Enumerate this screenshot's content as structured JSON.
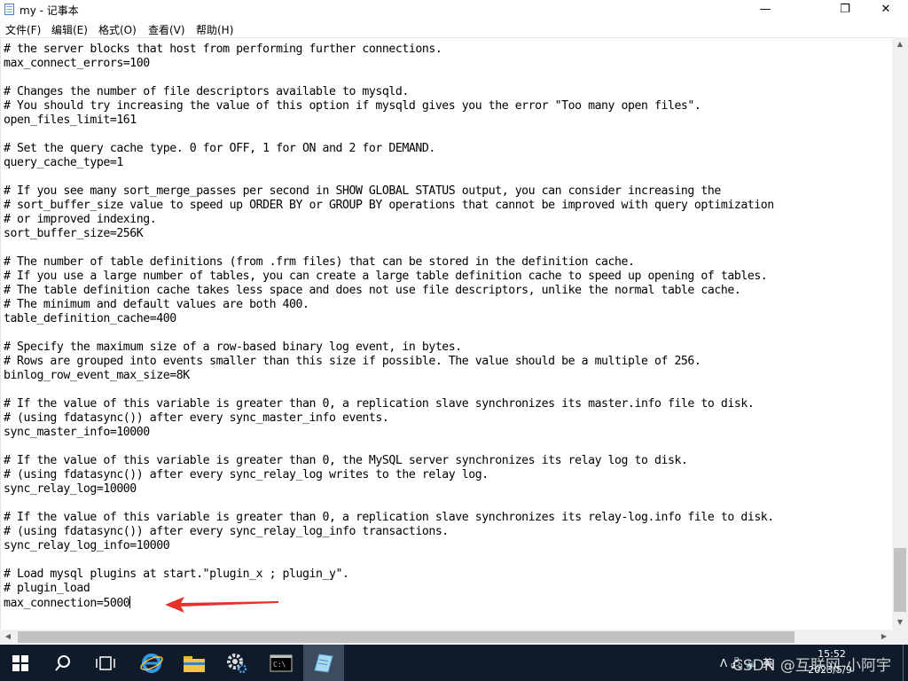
{
  "window": {
    "title": "my - 记事本",
    "minimize_glyph": "—",
    "maximize_glyph": "❐",
    "close_glyph": "✕"
  },
  "menu": {
    "items": [
      "文件(F)",
      "编辑(E)",
      "格式(O)",
      "查看(V)",
      "帮助(H)"
    ]
  },
  "editor": {
    "lines": [
      "# the server blocks that host from performing further connections.",
      "max_connect_errors=100",
      "",
      "# Changes the number of file descriptors available to mysqld.",
      "# You should try increasing the value of this option if mysqld gives you the error \"Too many open files\".",
      "open_files_limit=161",
      "",
      "# Set the query cache type. 0 for OFF, 1 for ON and 2 for DEMAND.",
      "query_cache_type=1",
      "",
      "# If you see many sort_merge_passes per second in SHOW GLOBAL STATUS output, you can consider increasing the",
      "# sort_buffer_size value to speed up ORDER BY or GROUP BY operations that cannot be improved with query optimization",
      "# or improved indexing.",
      "sort_buffer_size=256K",
      "",
      "# The number of table definitions (from .frm files) that can be stored in the definition cache.",
      "# If you use a large number of tables, you can create a large table definition cache to speed up opening of tables.",
      "# The table definition cache takes less space and does not use file descriptors, unlike the normal table cache.",
      "# The minimum and default values are both 400.",
      "table_definition_cache=400",
      "",
      "# Specify the maximum size of a row-based binary log event, in bytes.",
      "# Rows are grouped into events smaller than this size if possible. The value should be a multiple of 256.",
      "binlog_row_event_max_size=8K",
      "",
      "# If the value of this variable is greater than 0, a replication slave synchronizes its master.info file to disk.",
      "# (using fdatasync()) after every sync_master_info events.",
      "sync_master_info=10000",
      "",
      "# If the value of this variable is greater than 0, the MySQL server synchronizes its relay log to disk.",
      "# (using fdatasync()) after every sync_relay_log writes to the relay log.",
      "sync_relay_log=10000",
      "",
      "# If the value of this variable is greater than 0, a replication slave synchronizes its relay-log.info file to disk.",
      "# (using fdatasync()) after every sync_relay_log_info transactions.",
      "sync_relay_log_info=10000",
      "",
      "# Load mysql plugins at start.\"plugin_x ; plugin_y\".",
      "# plugin_load",
      "max_connection=5000"
    ]
  },
  "annotation": {
    "arrow_color": "#e8302a"
  },
  "taskbar": {
    "time": "15:52",
    "date": "2023/5/9",
    "tray_text": "ᐱ 🖧 🔈 英"
  },
  "watermark": "CSDN @互联网-小阿宇",
  "colors": {
    "taskbar_bg": "#0f1b2a",
    "accent_blue": "#1e88e5"
  }
}
